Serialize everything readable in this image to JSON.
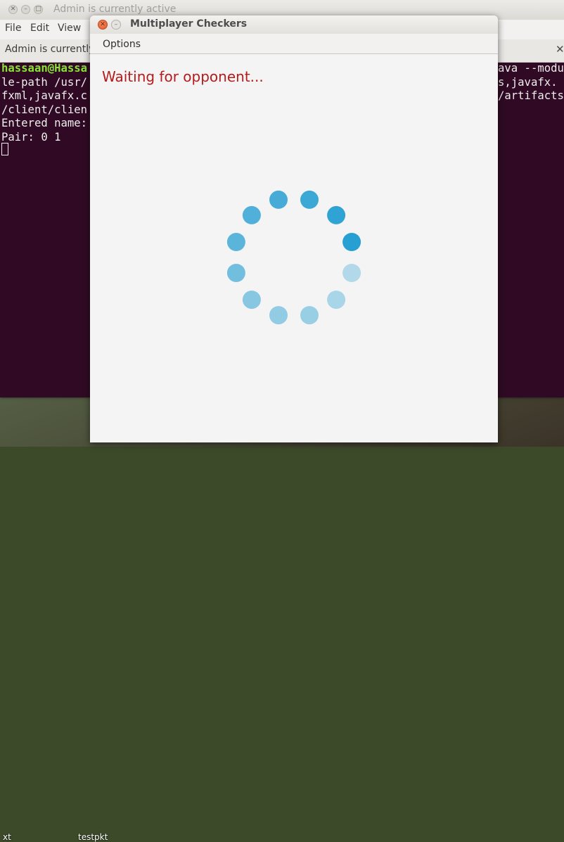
{
  "terminal": {
    "title": "Admin is currently active",
    "menu": [
      "File",
      "Edit",
      "View"
    ],
    "tab_label": "Admin is currently",
    "tab_close": "✕",
    "lines_left": [
      {
        "prompt": "hassaan@Hassa",
        "text": ""
      },
      {
        "prompt": "",
        "text": "le-path /usr/"
      },
      {
        "prompt": "",
        "text": "fxml,javafx.c"
      },
      {
        "prompt": "",
        "text": "/client/clien"
      },
      {
        "prompt": "",
        "text": "Entered name:"
      },
      {
        "prompt": "",
        "text": "Pair: 0 1"
      }
    ],
    "lines_right": [
      "ava --modu",
      "s,javafx.",
      "/artifacts"
    ]
  },
  "desktop": {
    "labels": [
      "xt",
      "testpkt"
    ]
  },
  "dialog": {
    "title": "Multiplayer Checkers",
    "menu_options": "Options",
    "status": "Waiting for opponent...",
    "spinner_color": "#1a9ad0",
    "close_glyph": "✕",
    "min_glyph": "–"
  },
  "spinner": {
    "dot_count": 12,
    "dot_opacities": [
      0.95,
      0.9,
      0.85,
      0.8,
      0.75,
      0.7,
      0.6,
      0.5,
      0.45,
      0.42,
      0.35,
      0.3
    ]
  }
}
